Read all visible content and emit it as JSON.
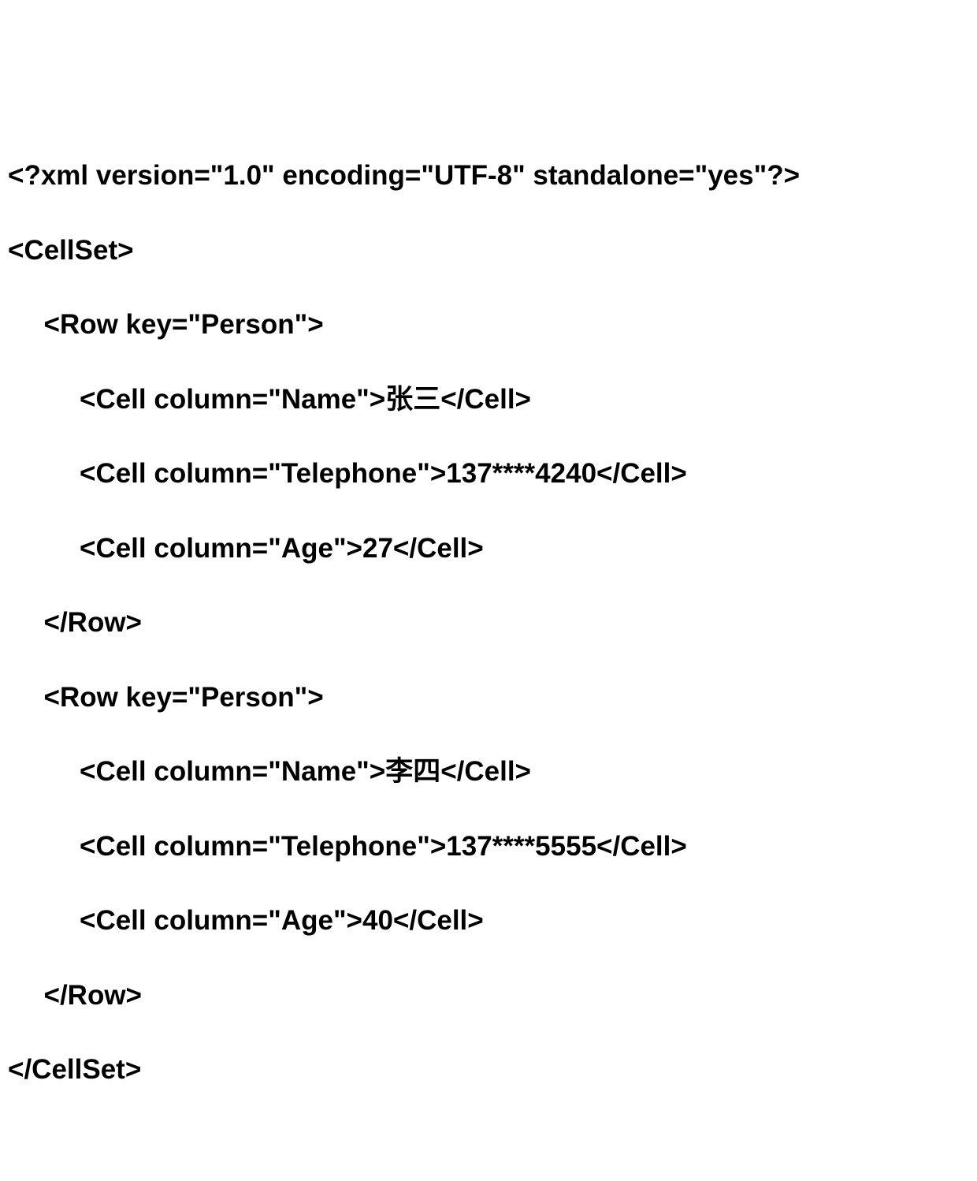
{
  "xml": {
    "declaration": "<?xml version=\"1.0\" encoding=\"UTF-8\" standalone=\"yes\"?>",
    "cellset_open": "<CellSet>",
    "cellset_close": "</CellSet>",
    "rows": [
      {
        "open": "<Row key=\"Person\">",
        "close": "</Row>",
        "cells": [
          "<Cell column=\"Name\">张三</Cell>",
          "<Cell column=\"Telephone\">137****4240</Cell>",
          "<Cell column=\"Age\">27</Cell>"
        ]
      },
      {
        "open": "<Row key=\"Person\">",
        "close": "</Row>",
        "cells": [
          "<Cell column=\"Name\">李四</Cell>",
          "<Cell column=\"Telephone\">137****5555</Cell>",
          "<Cell column=\"Age\">40</Cell>"
        ]
      }
    ]
  }
}
